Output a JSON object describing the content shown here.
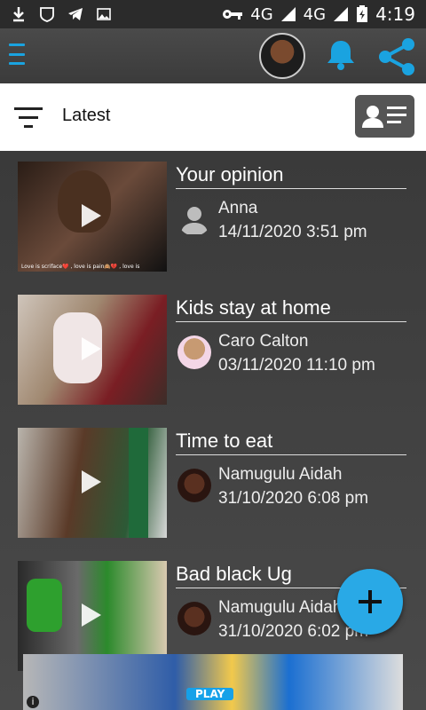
{
  "status_bar": {
    "network1": "4G",
    "network2": "4G",
    "network_badge": "4G",
    "time": "4:19"
  },
  "header": {
    "menu_icon": "hamburger-icon",
    "notifications_icon": "bell-icon",
    "share_icon": "share-icon",
    "accent_color": "#1aa3e0"
  },
  "filter": {
    "label": "Latest",
    "filter_icon": "filter-icon",
    "contacts_icon": "contact-card-icon"
  },
  "feed": [
    {
      "title": "Your opinion",
      "author": "Anna",
      "date": "14/11/2020 3:51 pm",
      "caption": "Love is scriface❤️ , love is pain🙈💔 , love is"
    },
    {
      "title": "Kids stay at home",
      "author": "Caro Calton",
      "date": "03/11/2020 11:10 pm"
    },
    {
      "title": "Time to eat",
      "author": "Namugulu Aidah",
      "date": "31/10/2020 6:08 pm"
    },
    {
      "title": "Bad black Ug",
      "author": "Namugulu Aidah",
      "date": "31/10/2020 6:02 pm"
    }
  ],
  "fab": {
    "icon": "plus-icon"
  },
  "ad": {
    "play_label": "PLAY",
    "info": "i"
  }
}
